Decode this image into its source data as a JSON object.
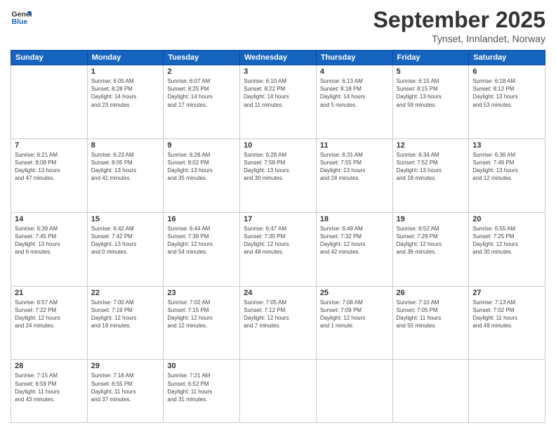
{
  "header": {
    "logo": {
      "line1": "General",
      "line2": "Blue"
    },
    "title": "September 2025",
    "location": "Tynset, Innlandet, Norway"
  },
  "weekdays": [
    "Sunday",
    "Monday",
    "Tuesday",
    "Wednesday",
    "Thursday",
    "Friday",
    "Saturday"
  ],
  "weeks": [
    [
      {
        "day": "",
        "info": ""
      },
      {
        "day": "1",
        "info": "Sunrise: 6:05 AM\nSunset: 8:28 PM\nDaylight: 14 hours\nand 23 minutes."
      },
      {
        "day": "2",
        "info": "Sunrise: 6:07 AM\nSunset: 8:25 PM\nDaylight: 14 hours\nand 17 minutes."
      },
      {
        "day": "3",
        "info": "Sunrise: 6:10 AM\nSunset: 8:22 PM\nDaylight: 14 hours\nand 11 minutes."
      },
      {
        "day": "4",
        "info": "Sunrise: 6:13 AM\nSunset: 8:18 PM\nDaylight: 14 hours\nand 5 minutes."
      },
      {
        "day": "5",
        "info": "Sunrise: 6:15 AM\nSunset: 8:15 PM\nDaylight: 13 hours\nand 59 minutes."
      },
      {
        "day": "6",
        "info": "Sunrise: 6:18 AM\nSunset: 8:12 PM\nDaylight: 13 hours\nand 53 minutes."
      }
    ],
    [
      {
        "day": "7",
        "info": "Sunrise: 6:21 AM\nSunset: 8:08 PM\nDaylight: 13 hours\nand 47 minutes."
      },
      {
        "day": "8",
        "info": "Sunrise: 6:23 AM\nSunset: 8:05 PM\nDaylight: 13 hours\nand 41 minutes."
      },
      {
        "day": "9",
        "info": "Sunrise: 6:26 AM\nSunset: 8:02 PM\nDaylight: 13 hours\nand 35 minutes."
      },
      {
        "day": "10",
        "info": "Sunrise: 6:28 AM\nSunset: 7:58 PM\nDaylight: 13 hours\nand 30 minutes."
      },
      {
        "day": "11",
        "info": "Sunrise: 6:31 AM\nSunset: 7:55 PM\nDaylight: 13 hours\nand 24 minutes."
      },
      {
        "day": "12",
        "info": "Sunrise: 6:34 AM\nSunset: 7:52 PM\nDaylight: 13 hours\nand 18 minutes."
      },
      {
        "day": "13",
        "info": "Sunrise: 6:36 AM\nSunset: 7:49 PM\nDaylight: 13 hours\nand 12 minutes."
      }
    ],
    [
      {
        "day": "14",
        "info": "Sunrise: 6:39 AM\nSunset: 7:45 PM\nDaylight: 13 hours\nand 6 minutes."
      },
      {
        "day": "15",
        "info": "Sunrise: 6:42 AM\nSunset: 7:42 PM\nDaylight: 13 hours\nand 0 minutes."
      },
      {
        "day": "16",
        "info": "Sunrise: 6:44 AM\nSunset: 7:39 PM\nDaylight: 12 hours\nand 54 minutes."
      },
      {
        "day": "17",
        "info": "Sunrise: 6:47 AM\nSunset: 7:35 PM\nDaylight: 12 hours\nand 48 minutes."
      },
      {
        "day": "18",
        "info": "Sunrise: 6:49 AM\nSunset: 7:32 PM\nDaylight: 12 hours\nand 42 minutes."
      },
      {
        "day": "19",
        "info": "Sunrise: 6:52 AM\nSunset: 7:29 PM\nDaylight: 12 hours\nand 36 minutes."
      },
      {
        "day": "20",
        "info": "Sunrise: 6:55 AM\nSunset: 7:25 PM\nDaylight: 12 hours\nand 30 minutes."
      }
    ],
    [
      {
        "day": "21",
        "info": "Sunrise: 6:57 AM\nSunset: 7:22 PM\nDaylight: 12 hours\nand 24 minutes."
      },
      {
        "day": "22",
        "info": "Sunrise: 7:00 AM\nSunset: 7:19 PM\nDaylight: 12 hours\nand 18 minutes."
      },
      {
        "day": "23",
        "info": "Sunrise: 7:02 AM\nSunset: 7:15 PM\nDaylight: 12 hours\nand 12 minutes."
      },
      {
        "day": "24",
        "info": "Sunrise: 7:05 AM\nSunset: 7:12 PM\nDaylight: 12 hours\nand 7 minutes."
      },
      {
        "day": "25",
        "info": "Sunrise: 7:08 AM\nSunset: 7:09 PM\nDaylight: 12 hours\nand 1 minute."
      },
      {
        "day": "26",
        "info": "Sunrise: 7:10 AM\nSunset: 7:05 PM\nDaylight: 11 hours\nand 55 minutes."
      },
      {
        "day": "27",
        "info": "Sunrise: 7:13 AM\nSunset: 7:02 PM\nDaylight: 11 hours\nand 49 minutes."
      }
    ],
    [
      {
        "day": "28",
        "info": "Sunrise: 7:15 AM\nSunset: 6:59 PM\nDaylight: 11 hours\nand 43 minutes."
      },
      {
        "day": "29",
        "info": "Sunrise: 7:18 AM\nSunset: 6:55 PM\nDaylight: 11 hours\nand 37 minutes."
      },
      {
        "day": "30",
        "info": "Sunrise: 7:21 AM\nSunset: 6:52 PM\nDaylight: 11 hours\nand 31 minutes."
      },
      {
        "day": "",
        "info": ""
      },
      {
        "day": "",
        "info": ""
      },
      {
        "day": "",
        "info": ""
      },
      {
        "day": "",
        "info": ""
      }
    ]
  ]
}
